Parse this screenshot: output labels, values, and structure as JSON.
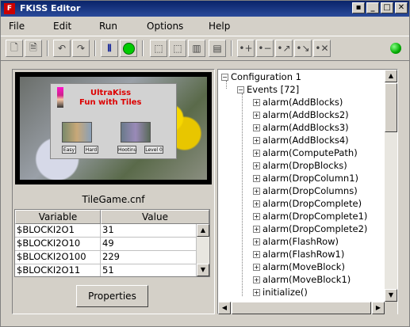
{
  "window": {
    "title": "FKiSS Editor",
    "app_icon": "flag-icon"
  },
  "menu": [
    "File",
    "Edit",
    "Run",
    "Options",
    "Help"
  ],
  "toolbar": {
    "icons": [
      "new-file-icon",
      "open-file-icon",
      "undo-icon",
      "redo-icon",
      "run-events-icon",
      "run-green-icon",
      "tool-a-icon",
      "tool-b-icon",
      "tool-c-icon",
      "tool-d-icon",
      "add-icon",
      "remove-icon",
      "move-up-icon",
      "move-down-icon",
      "delete-icon"
    ],
    "status_color": "#00aa00"
  },
  "preview": {
    "title_line1": "UltraKiss",
    "title_line2": "Fun with Tiles",
    "buttons": [
      "Easy",
      "Hard",
      "Hootinu",
      "Level 0"
    ]
  },
  "filename": "TileGame.cnf",
  "variables": {
    "headers": [
      "Variable",
      "Value"
    ],
    "rows": [
      {
        "name": "$BLOCKI2O1",
        "value": "31"
      },
      {
        "name": "$BLOCKI2O10",
        "value": "49"
      },
      {
        "name": "$BLOCKI2O100",
        "value": "229"
      },
      {
        "name": "$BLOCKI2O11",
        "value": "51"
      }
    ]
  },
  "properties_label": "Properties",
  "tree": {
    "root": "Configuration 1",
    "events_label": "Events  [72]",
    "items": [
      "alarm(AddBlocks)",
      "alarm(AddBlocks2)",
      "alarm(AddBlocks3)",
      "alarm(AddBlocks4)",
      "alarm(ComputePath)",
      "alarm(DropBlocks)",
      "alarm(DropColumn1)",
      "alarm(DropColumns)",
      "alarm(DropComplete)",
      "alarm(DropComplete1)",
      "alarm(DropComplete2)",
      "alarm(FlashRow)",
      "alarm(FlashRow1)",
      "alarm(MoveBlock)",
      "alarm(MoveBlock1)",
      "initialize()"
    ]
  }
}
